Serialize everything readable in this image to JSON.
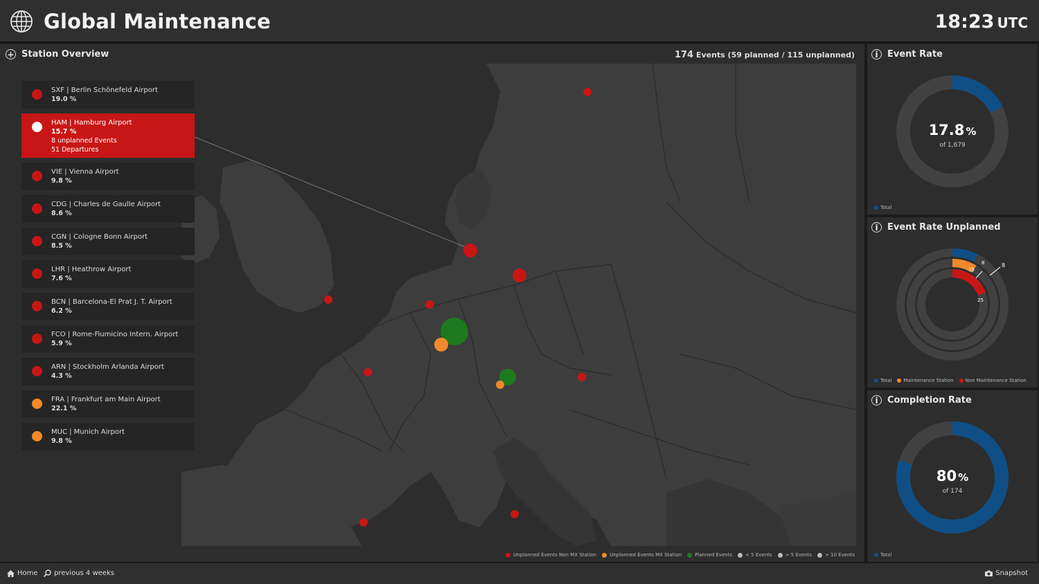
{
  "header": {
    "title": "Global Maintenance",
    "time": "18:23",
    "tz": "UTC",
    "icon": "globe-icon"
  },
  "overview": {
    "title": "Station Overview",
    "events_total": "174",
    "events_detail": "Events (59 planned / 115 unplanned)"
  },
  "stations": [
    {
      "code_name": "SXF | Berlin Schönefeld Airport",
      "pct": "19.0 %",
      "color": "#c81616"
    },
    {
      "code_name": "HAM | Hamburg Airport",
      "pct": "15.7 %",
      "color": "#ffffff",
      "extra1": "8 unplanned Events",
      "extra2": "51 Departures",
      "active": true
    },
    {
      "code_name": "VIE | Vienna Airport",
      "pct": "9.8 %",
      "color": "#c81616"
    },
    {
      "code_name": "CDG | Charles de Gaulle Airport",
      "pct": "8.6 %",
      "color": "#c81616"
    },
    {
      "code_name": "CGN | Cologne Bonn Airport",
      "pct": "8.5 %",
      "color": "#c81616"
    },
    {
      "code_name": "LHR | Heathrow Airport",
      "pct": "7.6 %",
      "color": "#c81616"
    },
    {
      "code_name": "BCN | Barcelona-El Prat J. T. Airport",
      "pct": "6.2 %",
      "color": "#c81616"
    },
    {
      "code_name": "FCO | Rome-Fiumicino Intern. Airport",
      "pct": "5.9 %",
      "color": "#c81616"
    },
    {
      "code_name": "ARN | Stockholm Arlanda Airport",
      "pct": "4.3 %",
      "color": "#c81616"
    },
    {
      "code_name": "FRA | Frankfurt am Main Airport",
      "pct": "22.1 %",
      "color": "#f0892b"
    },
    {
      "code_name": "MUC | Munich Airport",
      "pct": "9.8 %",
      "color": "#f0892b"
    }
  ],
  "map_legend": [
    {
      "label": "Unplanned Events Non MX Station",
      "color": "#c81616"
    },
    {
      "label": "Unplanned Events MX Station",
      "color": "#f0892b"
    },
    {
      "label": "Planned Events",
      "color": "#1e7a1e"
    },
    {
      "label": "< 5 Events",
      "color": "#bbbbbb"
    },
    {
      "label": "> 5 Events",
      "color": "#bbbbbb"
    },
    {
      "label": "> 10 Events",
      "color": "#bbbbbb"
    }
  ],
  "event_rate": {
    "title": "Event Rate",
    "value": "17.8",
    "unit": "%",
    "sub": "of 1,679",
    "fraction": 0.178,
    "legend": "Total",
    "color": "#0f4f86"
  },
  "event_rate_unplanned": {
    "title": "Event Rate Unplanned",
    "legend": [
      "Total",
      "Maintenance Station",
      "Non Maintenance Station"
    ],
    "legend_colors": [
      "#0f4f86",
      "#f0892b",
      "#c81616"
    ],
    "ring_labels": [
      "8",
      "35",
      "25",
      "8"
    ]
  },
  "completion_rate": {
    "title": "Completion Rate",
    "value": "80",
    "unit": "%",
    "sub": "of 174",
    "fraction": 0.8,
    "legend": "Total",
    "color": "#0f4f86"
  },
  "footer": {
    "home": "Home",
    "range": "previous 4 weeks",
    "snapshot": "Snapshot"
  }
}
